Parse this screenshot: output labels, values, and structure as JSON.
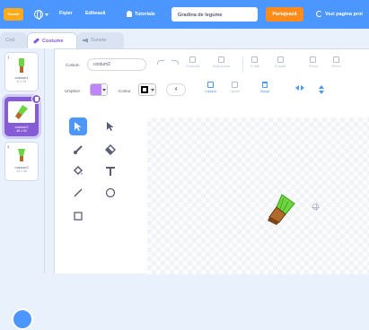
{
  "menubar": {
    "logo_text": "Scratch",
    "file": "Fişier",
    "edit": "Editează",
    "tutorials": "Tutoriale",
    "project_title": "Gradina de legume",
    "share": "Partajează",
    "project_page": "Vezi pagina proi"
  },
  "tabs": {
    "code": "Cod",
    "costumes": "Costume",
    "sounds": "Sunete"
  },
  "costumes": [
    {
      "number": "1",
      "name": "costum1",
      "size": "40 x 51"
    },
    {
      "number": "2",
      "name": "costum2",
      "size": "48 x 50"
    },
    {
      "number": "3",
      "name": "costum3",
      "size": "45 x 48"
    }
  ],
  "editor": {
    "costume_label": "Costum",
    "costume_name": "costum2",
    "group": "Grupează",
    "ungroup": "Degrupează",
    "forward": "În față",
    "backward": "În spate",
    "front": "Primul",
    "back": "Ultimul",
    "fill_label": "Umplere",
    "outline_label": "Contur",
    "outline_width": "4",
    "copy": "Copiază",
    "paste": "Lipește",
    "delete": "Șterge"
  },
  "colors": {
    "menubar": "#4c97ff",
    "accent": "#855cd6",
    "share": "#ff8c1a",
    "fill": "#c084fc",
    "outline": "#000000"
  }
}
